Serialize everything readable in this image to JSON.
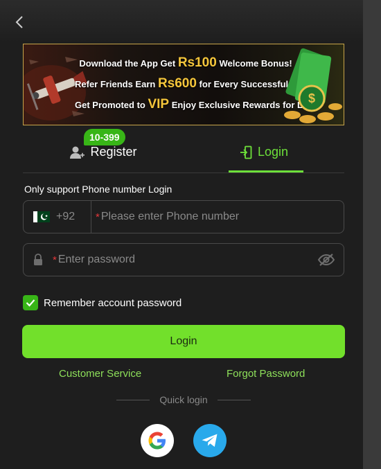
{
  "header": {
    "back_icon": "chevron-left-icon"
  },
  "banner": {
    "line1_pre": "Download the App  Get ",
    "line1_amount": "Rs100",
    "line1_post": " Welcome Bonus!",
    "line2_pre": "Refer Friends  Earn ",
    "line2_amount": "Rs600",
    "line2_post": " for Every Successful Referral!",
    "line3_pre": "Get Promoted to ",
    "line3_amount": "VIP",
    "line3_post": "  Enjoy Exclusive Rewards for Life!"
  },
  "tabs": {
    "register_label": "Register",
    "register_badge": "10-399",
    "login_label": "Login",
    "active": "login"
  },
  "form": {
    "support_text": "Only support Phone number Login",
    "country_code": "+92",
    "country_flag": "pakistan-flag-icon",
    "phone_required_mark": "*",
    "phone_placeholder": "Please enter Phone number",
    "password_required_mark": "*",
    "password_placeholder": "Enter password",
    "remember_label": "Remember account password",
    "remember_checked": true,
    "login_button": "Login"
  },
  "links": {
    "customer_service": "Customer Service",
    "forgot_password": "Forgot Password"
  },
  "quick_login": {
    "label": "Quick login",
    "providers": [
      "google-icon",
      "telegram-icon"
    ]
  },
  "colors": {
    "accent": "#72e02b",
    "link": "#8ee05a",
    "badge": "#38b517",
    "required": "#e5383b",
    "banner_gold": "#f5c63b",
    "telegram": "#29a9eb"
  }
}
